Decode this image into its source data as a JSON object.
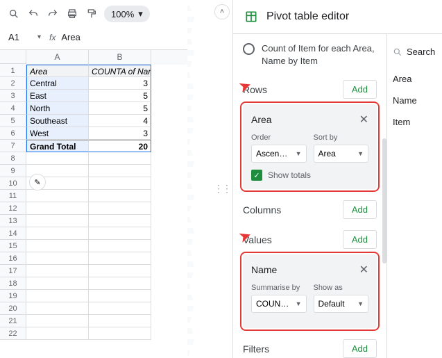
{
  "toolbar": {
    "zoom": "100%"
  },
  "cell_ref": {
    "ref": "A1",
    "formula_value": "Area"
  },
  "grid": {
    "col_A": "A",
    "col_B": "B",
    "header_A": "Area",
    "header_B": "COUNTA of Name",
    "rows": [
      {
        "a": "Central",
        "b": "3"
      },
      {
        "a": "East",
        "b": "5"
      },
      {
        "a": "North",
        "b": "5"
      },
      {
        "a": "Southeast",
        "b": "4"
      },
      {
        "a": "West",
        "b": "3"
      }
    ],
    "total_label": "Grand Total",
    "total_value": "20",
    "row_nums": [
      "1",
      "2",
      "3",
      "4",
      "5",
      "6",
      "7",
      "8",
      "9",
      "10",
      "11",
      "12",
      "13",
      "14",
      "15",
      "16",
      "17",
      "18",
      "19",
      "20",
      "21",
      "22"
    ]
  },
  "editor": {
    "title": "Pivot table editor",
    "suggestion": "Count of Item for each Area, Name by Item",
    "rows_label": "Rows",
    "columns_label": "Columns",
    "values_label": "Values",
    "filters_label": "Filters",
    "add_label": "Add",
    "search_label": "Search",
    "side_fields": [
      "Area",
      "Name",
      "Item"
    ],
    "area_card": {
      "title": "Area",
      "order_label": "Order",
      "order_value": "Ascen…",
      "sort_label": "Sort by",
      "sort_value": "Area",
      "show_totals": "Show totals"
    },
    "name_card": {
      "title": "Name",
      "summarise_label": "Summarise by",
      "summarise_value": "COUN…",
      "showas_label": "Show as",
      "showas_value": "Default"
    }
  }
}
